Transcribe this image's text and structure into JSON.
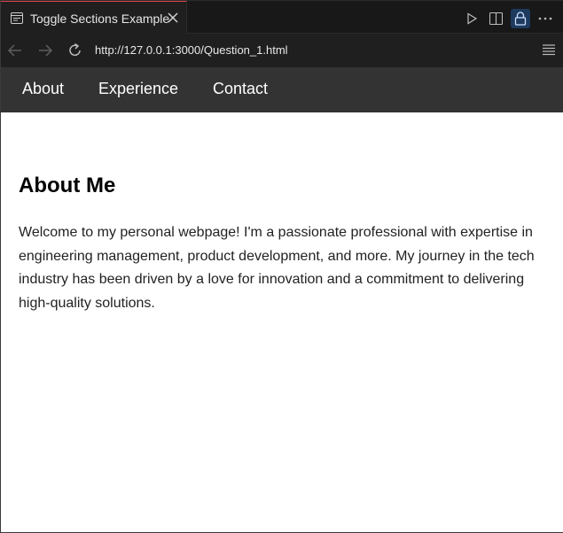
{
  "browser": {
    "tab_title": "Toggle Sections Example",
    "url": "http://127.0.0.1:3000/Question_1.html",
    "tab_icon": "page-icon",
    "actions": [
      "play-icon",
      "split-editor-icon",
      "lock-icon",
      "more-icon"
    ],
    "accent_color": "#e0464b"
  },
  "page": {
    "nav": {
      "items": [
        "About",
        "Experience",
        "Contact"
      ],
      "background": "#333333"
    },
    "about": {
      "heading": "About Me",
      "body": "Welcome to my personal webpage! I'm a passionate professional with expertise in engineering management, product development, and more. My journey in the tech industry has been driven by a love for innovation and a commitment to delivering high-quality solutions."
    }
  }
}
